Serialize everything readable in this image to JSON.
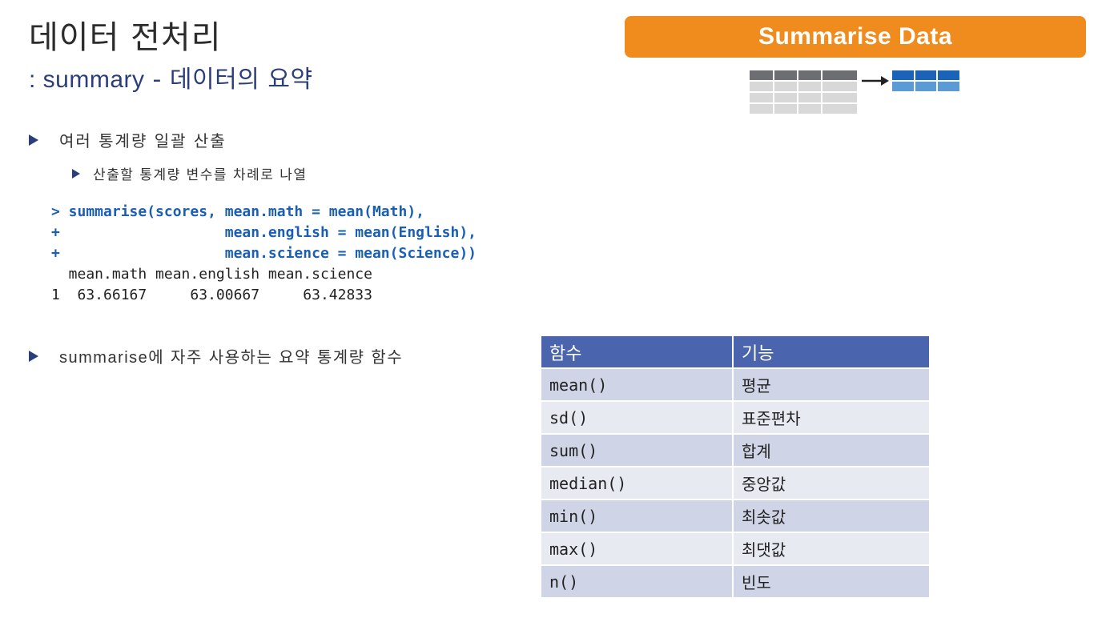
{
  "slide": {
    "title": "데이터 전처리",
    "subtitle_prefix": ": summary",
    "subtitle_sep": " - ",
    "subtitle_rest": "데이터의 요약"
  },
  "badge": {
    "label": "Summarise Data",
    "color": "#f08c1e"
  },
  "bullets": {
    "b1": "여러 통계량 일괄 산출",
    "b2": "산출할 통계량 변수를 차례로 나열",
    "b3_en": "summarise",
    "b3_rest": "에 자주 사용하는 요약 통계량 함수"
  },
  "code": {
    "input_lines": [
      "> summarise(scores, mean.math = mean(Math),",
      "+                   mean.english = mean(English),",
      "+                   mean.science = mean(Science))"
    ],
    "output_lines": [
      "  mean.math mean.english mean.science",
      "1  63.66167     63.00667     63.42833"
    ]
  },
  "table": {
    "headers": [
      "함수",
      "기능"
    ],
    "rows": [
      [
        "mean()",
        "평균"
      ],
      [
        "sd()",
        "표준편차"
      ],
      [
        "sum()",
        "합계"
      ],
      [
        "median()",
        "중앙값"
      ],
      [
        "min()",
        "최솟값"
      ],
      [
        "max()",
        "최댓값"
      ],
      [
        "n()",
        "빈도"
      ]
    ],
    "header_color": "#4a64ae"
  }
}
